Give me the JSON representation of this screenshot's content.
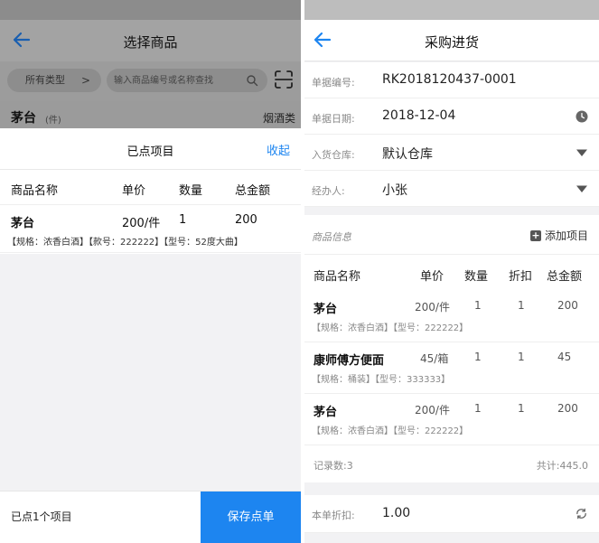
{
  "left": {
    "title": "选择商品",
    "filter": {
      "type_label": "所有类型",
      "search_placeholder": "输入商品编号或名称查找"
    },
    "dim_item": {
      "name": "茅台",
      "unit": "(件)",
      "category": "烟酒类"
    },
    "sheet": {
      "title": "已点项目",
      "collapse_label": "收起",
      "columns": [
        "商品名称",
        "单价",
        "数量",
        "总金额"
      ],
      "items": [
        {
          "name": "茅台",
          "price": "200/件",
          "qty": "1",
          "total": "200",
          "attrs": "【规格：浓香白酒】【款号：222222】【型号：52度大曲】"
        }
      ]
    },
    "footer": {
      "count_text": "已点1个项目",
      "save_label": "保存点单"
    }
  },
  "right": {
    "title": "采购进货",
    "form": {
      "order_no": {
        "label": "单据编号:",
        "value": "RK2018120437-0001"
      },
      "order_date": {
        "label": "单据日期:",
        "value": "2018-12-04"
      },
      "warehouse": {
        "label": "入货仓库:",
        "value": "默认仓库"
      },
      "handler": {
        "label": "经办人:",
        "value": "小张"
      }
    },
    "goods": {
      "section_label": "商品信息",
      "add_label": "添加项目",
      "columns": [
        "商品名称",
        "单价",
        "数量",
        "折扣",
        "总金额"
      ],
      "rows": [
        {
          "name": "茅台",
          "price": "200/件",
          "qty": "1",
          "discount": "1",
          "total": "200",
          "attrs": "【规格：浓香白酒】【型号：222222】"
        },
        {
          "name": "康师傅方便面",
          "price": "45/箱",
          "qty": "1",
          "discount": "1",
          "total": "45",
          "attrs": "【规格：桶装】【型号：333333】"
        },
        {
          "name": "茅台",
          "price": "200/件",
          "qty": "1",
          "discount": "1",
          "total": "200",
          "attrs": "【规格：浓香白酒】【型号：222222】"
        }
      ],
      "record_count": "记录数:3",
      "sum_text": "共计:445.0"
    },
    "discount": {
      "label": "本单折扣:",
      "value": "1.00"
    }
  },
  "colors": {
    "accent": "#1d85f0",
    "overlay": "#a3a3a3"
  }
}
